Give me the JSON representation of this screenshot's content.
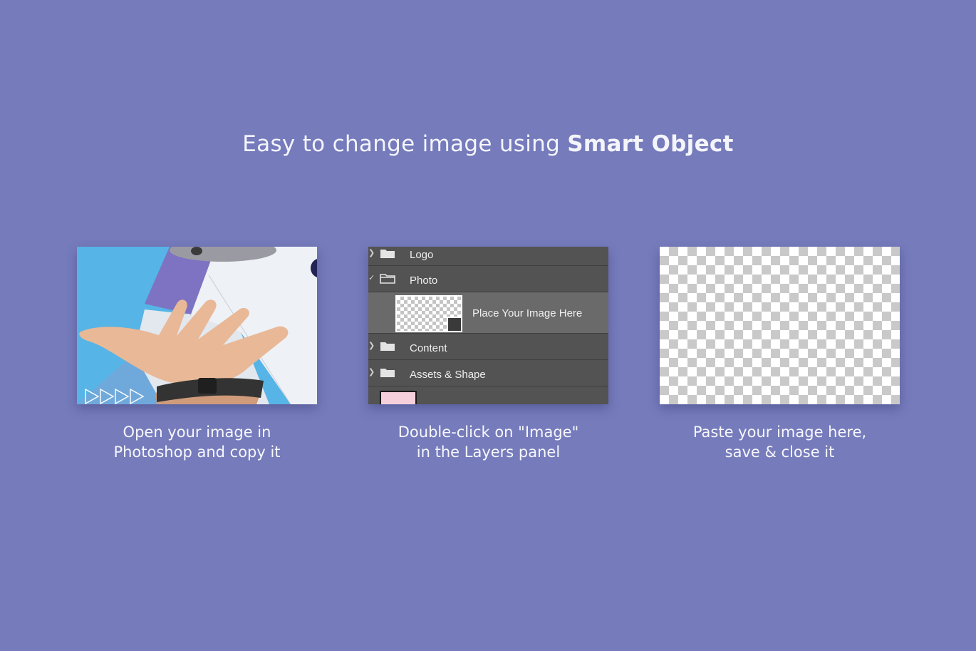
{
  "headline": {
    "prefix": "Easy to change image using ",
    "emphasis": "Smart Object"
  },
  "steps": [
    {
      "caption_line1": "Open your image in",
      "caption_line2": "Photoshop and copy it"
    },
    {
      "caption_line1": "Double-click on \"Image\"",
      "caption_line2": "in the Layers panel"
    },
    {
      "caption_line1": "Paste your image here,",
      "caption_line2": "save & close it"
    }
  ],
  "layers_panel": {
    "layers": [
      {
        "label": "Logo",
        "icon": "folder-icon"
      },
      {
        "label": "Photo",
        "icon": "folder-open-icon"
      },
      {
        "label": "Place Your Image Here",
        "icon": "smart-object-icon"
      },
      {
        "label": "Content",
        "icon": "folder-icon"
      },
      {
        "label": "Assets & Shape",
        "icon": "folder-icon"
      }
    ]
  },
  "colors": {
    "background": "#757bbb",
    "panel": "#535353",
    "panel_selected": "#6a6a6a",
    "photo_blue": "#56b4e6",
    "photo_purple": "#7e72c2"
  }
}
